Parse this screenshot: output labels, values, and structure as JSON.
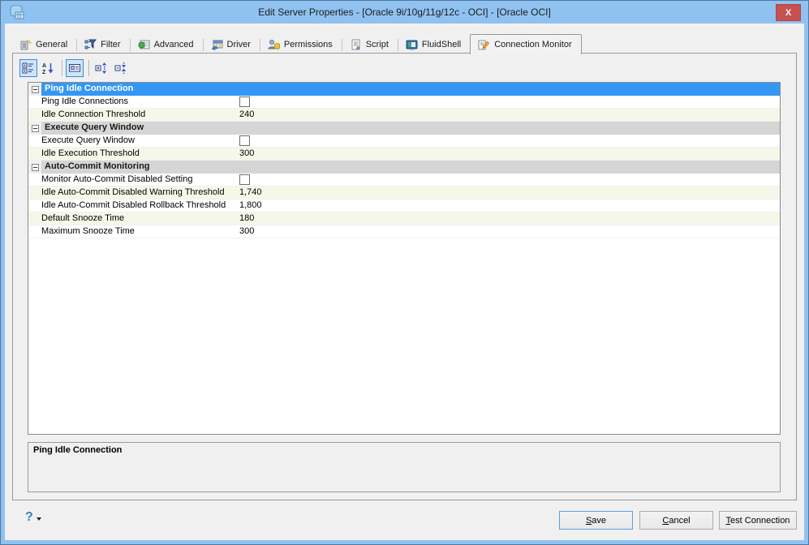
{
  "window": {
    "title": "Edit Server Properties - [Oracle 9i/10g/11g/12c - OCI] - [Oracle OCI]",
    "close_glyph": "X"
  },
  "colors": {
    "titlebar": "#8fc2f0",
    "close_red": "#c75050",
    "selected_header_blue": "#3397f3",
    "category_header_gray": "#d5d5d5",
    "row_cream": "#f7f7e9",
    "toolbar_selected_bg": "#cde6f7",
    "toolbar_selected_border": "#3d8ae0"
  },
  "tabs": [
    {
      "label": "General",
      "icon": "general-icon"
    },
    {
      "label": "Filter",
      "icon": "filter-icon"
    },
    {
      "label": "Advanced",
      "icon": "advanced-icon"
    },
    {
      "label": "Driver",
      "icon": "driver-icon"
    },
    {
      "label": "Permissions",
      "icon": "permissions-icon"
    },
    {
      "label": "Script",
      "icon": "script-icon"
    },
    {
      "label": "FluidShell",
      "icon": "fluidshell-icon"
    },
    {
      "label": "Connection Monitor",
      "icon": "connection-monitor-icon",
      "active": true
    }
  ],
  "toolbar": {
    "buttons": [
      {
        "name": "categorized-view",
        "selected": true
      },
      {
        "name": "alphabetical-sort",
        "selected": false
      },
      {
        "name": "show-description",
        "selected": true
      },
      {
        "name": "expand-all",
        "selected": false
      },
      {
        "name": "collapse-all",
        "selected": false
      }
    ]
  },
  "grid": {
    "rows": [
      {
        "type": "header",
        "label": "Ping Idle Connection",
        "selected": true
      },
      {
        "type": "prop",
        "label": "Ping Idle Connections",
        "value_type": "checkbox",
        "checked": false
      },
      {
        "type": "prop",
        "label": "Idle Connection Threshold",
        "value": "240"
      },
      {
        "type": "header",
        "label": "Execute Query Window",
        "selected": false
      },
      {
        "type": "prop",
        "label": "Execute Query Window",
        "value_type": "checkbox",
        "checked": false
      },
      {
        "type": "prop",
        "label": "Idle Execution Threshold",
        "value": "300"
      },
      {
        "type": "header",
        "label": "Auto-Commit Monitoring",
        "selected": false
      },
      {
        "type": "prop",
        "label": "Monitor Auto-Commit Disabled Setting",
        "value_type": "checkbox",
        "checked": false
      },
      {
        "type": "prop",
        "label": "Idle Auto-Commit Disabled Warning Threshold",
        "value": "1,740"
      },
      {
        "type": "prop",
        "label": "Idle Auto-Commit Disabled Rollback Threshold",
        "value": "1,800"
      },
      {
        "type": "prop",
        "label": "Default Snooze Time",
        "value": "180"
      },
      {
        "type": "prop",
        "label": "Maximum Snooze Time",
        "value": "300"
      }
    ]
  },
  "description": {
    "title": "Ping Idle Connection"
  },
  "buttons": {
    "save": {
      "key": "S",
      "rest": "ave"
    },
    "cancel": {
      "key": "C",
      "rest": "ancel"
    },
    "test": {
      "key": "T",
      "rest": "est Connection"
    }
  },
  "help": {
    "glyph": "?"
  }
}
